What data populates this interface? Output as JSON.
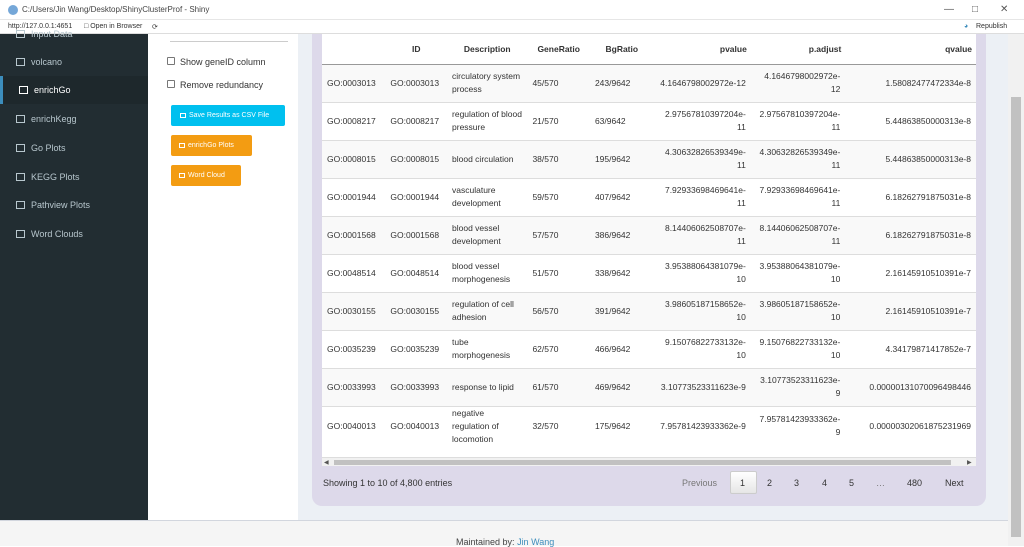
{
  "window": {
    "title": "C:/Users/Jin Wang/Desktop/ShinyClusterProf - Shiny",
    "url": "http://127.0.0.1:4651",
    "open_in_browser": "Open in Browser",
    "republish": "Republish"
  },
  "sidebar": {
    "items": [
      {
        "label": "Input Data"
      },
      {
        "label": "volcano"
      },
      {
        "label": "enrichGo"
      },
      {
        "label": "enrichKegg"
      },
      {
        "label": "Go Plots"
      },
      {
        "label": "KEGG Plots"
      },
      {
        "label": "Pathview Plots"
      },
      {
        "label": "Word Clouds"
      }
    ]
  },
  "options": {
    "show_geneid": "Show geneID column",
    "remove_redundancy": "Remove redundancy"
  },
  "buttons": {
    "save_csv": "Save Results as CSV File",
    "enrichgo_plots": "enrichGo Plots",
    "word_cloud": "Word Cloud"
  },
  "colors": {
    "save_csv": "#00c0ef",
    "orange": "#f39c12",
    "sidebar": "#222d32"
  },
  "table": {
    "headers": [
      "",
      "ID",
      "Description",
      "GeneRatio",
      "BgRatio",
      "pvalue",
      "p.adjust",
      "qvalue"
    ],
    "rows": [
      [
        "GO:0003013",
        "GO:0003013",
        "circulatory system process",
        "45/570",
        "243/9642",
        "4.1646798002972e-12",
        "4.1646798002972e-12",
        "1.58082477472334e-8"
      ],
      [
        "GO:0008217",
        "GO:0008217",
        "regulation of blood pressure",
        "21/570",
        "63/9642",
        "2.97567810397204e-11",
        "2.97567810397204e-11",
        "5.44863850000313e-8"
      ],
      [
        "GO:0008015",
        "GO:0008015",
        "blood circulation",
        "38/570",
        "195/9642",
        "4.30632826539349e-11",
        "4.30632826539349e-11",
        "5.44863850000313e-8"
      ],
      [
        "GO:0001944",
        "GO:0001944",
        "vasculature development",
        "59/570",
        "407/9642",
        "7.92933698469641e-11",
        "7.92933698469641e-11",
        "6.18262791875031e-8"
      ],
      [
        "GO:0001568",
        "GO:0001568",
        "blood vessel development",
        "57/570",
        "386/9642",
        "8.14406062508707e-11",
        "8.14406062508707e-11",
        "6.18262791875031e-8"
      ],
      [
        "GO:0048514",
        "GO:0048514",
        "blood vessel morphogenesis",
        "51/570",
        "338/9642",
        "3.95388064381079e-10",
        "3.95388064381079e-10",
        "2.16145910510391e-7"
      ],
      [
        "GO:0030155",
        "GO:0030155",
        "regulation of cell adhesion",
        "56/570",
        "391/9642",
        "3.98605187158652e-10",
        "3.98605187158652e-10",
        "2.16145910510391e-7"
      ],
      [
        "GO:0035239",
        "GO:0035239",
        "tube morphogenesis",
        "62/570",
        "466/9642",
        "9.15076822733132e-10",
        "9.15076822733132e-10",
        "4.34179871417852e-7"
      ],
      [
        "GO:0033993",
        "GO:0033993",
        "response to lipid",
        "61/570",
        "469/9642",
        "3.10773523311623e-9",
        "3.10773523311623e-9",
        "0.00000131070096498446"
      ],
      [
        "GO:0040013",
        "GO:0040013",
        "negative regulation of locomotion",
        "32/570",
        "175/9642",
        "7.95781423933362e-9",
        "7.95781423933362e-9",
        "0.00000302061875231969"
      ]
    ]
  },
  "pagination": {
    "info": "Showing 1 to 10 of 4,800 entries",
    "previous": "Previous",
    "pages": [
      "1",
      "2",
      "3",
      "4",
      "5",
      "…",
      "480"
    ],
    "next": "Next"
  },
  "footer": {
    "maintained_by": "Maintained by:",
    "author": "Jin Wang"
  }
}
